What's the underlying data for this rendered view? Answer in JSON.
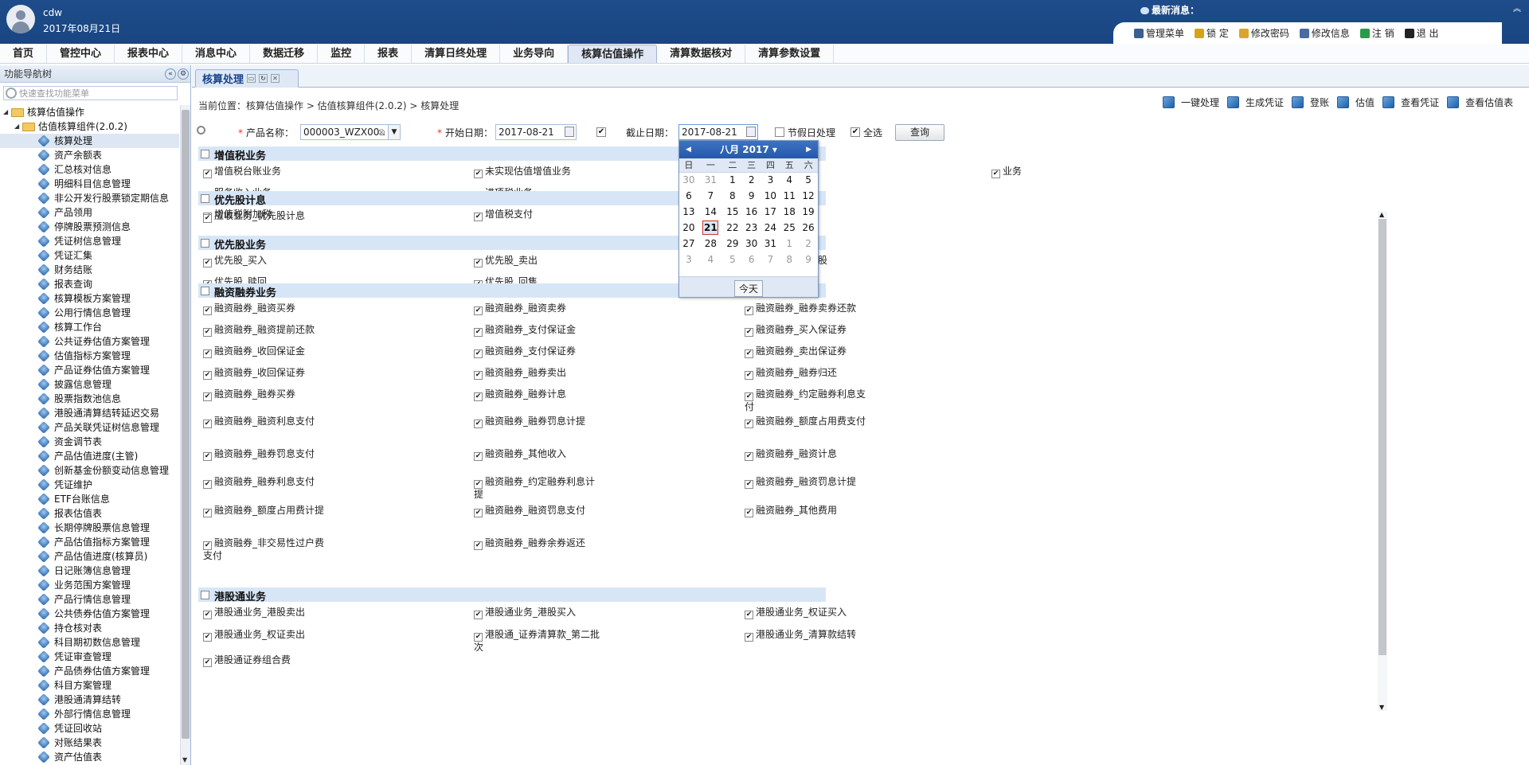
{
  "header": {
    "username": "cdw",
    "date": "2017年08月21日",
    "news": "最新消息：",
    "tools": [
      {
        "label": "管理菜单",
        "icon": "gear-icon",
        "color": "#3b5f8f"
      },
      {
        "label": "锁 定",
        "icon": "lock-icon",
        "color": "#d4a21f"
      },
      {
        "label": "修改密码",
        "icon": "key-icon",
        "color": "#d9a52a"
      },
      {
        "label": "修改信息",
        "icon": "user-icon",
        "color": "#4a6aa0"
      },
      {
        "label": "注 销",
        "icon": "logout-icon",
        "color": "#2a9a4a"
      },
      {
        "label": "退 出",
        "icon": "power-icon",
        "color": "#222"
      }
    ]
  },
  "nav": [
    "首页",
    "管控中心",
    "报表中心",
    "消息中心",
    "数据迁移",
    "监控",
    "报表",
    "清算日终处理",
    "业务导向",
    "核算估值操作",
    "清算数据核对",
    "清算参数设置"
  ],
  "left": {
    "title": "功能导航树",
    "search_placeholder": "快速查找功能菜单",
    "root": "核算估值操作",
    "group": "估值核算组件(2.0.2)",
    "items": [
      "核算处理",
      "资产余额表",
      "汇总核对信息",
      "明细科目信息管理",
      "非公开发行股票锁定期信息",
      "产品领用",
      "停牌股票预测信息",
      "凭证树信息管理",
      "凭证汇集",
      "财务结账",
      "报表查询",
      "核算模板方案管理",
      "公用行情信息管理",
      "核算工作台",
      "公共证券估值方案管理",
      "估值指标方案管理",
      "产品证券估值方案管理",
      "披露信息管理",
      "股票指数池信息",
      "港股通清算结转延迟交易",
      "产品关联凭证树信息管理",
      "资金调节表",
      "产品估值进度(主管)",
      "创新基金份额变动信息管理",
      "凭证维护",
      "ETF台账信息",
      "报表估值表",
      "长期停牌股票信息管理",
      "产品估值指标方案管理",
      "产品估值进度(核算员)",
      "日记账簿信息管理",
      "业务范围方案管理",
      "产品行情信息管理",
      "公共债券估值方案管理",
      "持仓核对表",
      "科目期初数信息管理",
      "凭证审查管理",
      "产品债券估值方案管理",
      "科目方案管理",
      "港股通清算结转",
      "外部行情信息管理",
      "凭证回收站",
      "对账结果表",
      "资产估值表"
    ]
  },
  "tab": {
    "label": "核算处理"
  },
  "breadcrumb": "当前位置：核算估值操作 > 估值核算组件(2.0.2) > 核算处理",
  "actions": [
    "一键处理",
    "生成凭证",
    "登账",
    "估值",
    "查看凭证",
    "查看估值表"
  ],
  "query": {
    "product_label": "产品名称：",
    "product_value": "000003_WZX00..",
    "start_label": "开始日期：",
    "start_value": "2017-08-21",
    "end_label": "截止日期：",
    "end_value": "2017-08-21",
    "holiday": "节假日处理",
    "all": "全选",
    "btn": "查询"
  },
  "sections": [
    {
      "title": "增值税业务",
      "items": [
        "增值税台账业务",
        "未实现估值增值业务",
        "业务",
        "服务收入业务",
        "进项税业务",
        "",
        "增值税附加税",
        "增值税支付",
        ""
      ]
    },
    {
      "title": "优先股计息",
      "items": [
        "应收业务_优先股计息"
      ]
    },
    {
      "title": "优先股业务",
      "items": [
        "优先股_买入",
        "优先股_卖出",
        "优先股_转普通股",
        "优先股_赎回",
        "优先股_回售"
      ]
    },
    {
      "title": "融资融券业务",
      "items": [
        "融资融券_融资买券",
        "融资融券_融资卖券",
        "融资融券_融券卖券还款",
        "融资融券_融资提前还款",
        "融资融券_支付保证金",
        "融资融券_买入保证券",
        "融资融券_收回保证金",
        "融资融券_支付保证券",
        "融资融券_卖出保证券",
        "融资融券_收回保证券",
        "融资融券_融券卖出",
        "融资融券_融券归还",
        "融资融券_融券买券",
        "融资融券_融券计息",
        "融资融券_约定融券利息支付",
        "融资融券_融资利息支付",
        "融资融券_融券罚息计提",
        "融资融券_额度占用费支付",
        "融资融券_融券罚息支付",
        "融资融券_其他收入",
        "融资融券_融资计息",
        "融资融券_融券利息支付",
        "融资融券_约定融券利息计提",
        "融资融券_融资罚息计提",
        "融资融券_额度占用费计提",
        "融资融券_融资罚息支付",
        "融资融券_其他费用",
        "融资融券_非交易性过户费支付",
        "融资融券_融券余券返还"
      ]
    },
    {
      "title": "港股通业务",
      "items": [
        "港股通业务_港股卖出",
        "港股通业务_港股买入",
        "港股通业务_权证买入",
        "港股通业务_权证卖出",
        "港股通_证券清算款_第二批次",
        "港股通业务_清算款结转",
        "港股通证券组合费"
      ]
    }
  ],
  "calendar": {
    "title": "八月 2017",
    "weekdays": [
      "日",
      "一",
      "二",
      "三",
      "四",
      "五",
      "六"
    ],
    "rows": [
      [
        "30",
        "31",
        "1",
        "2",
        "3",
        "4",
        "5"
      ],
      [
        "6",
        "7",
        "8",
        "9",
        "10",
        "11",
        "12"
      ],
      [
        "13",
        "14",
        "15",
        "16",
        "17",
        "18",
        "19"
      ],
      [
        "20",
        "21",
        "22",
        "23",
        "24",
        "25",
        "26"
      ],
      [
        "27",
        "28",
        "29",
        "30",
        "31",
        "1",
        "2"
      ],
      [
        "3",
        "4",
        "5",
        "6",
        "7",
        "8",
        "9"
      ]
    ],
    "selected": "21",
    "today": "今天"
  }
}
